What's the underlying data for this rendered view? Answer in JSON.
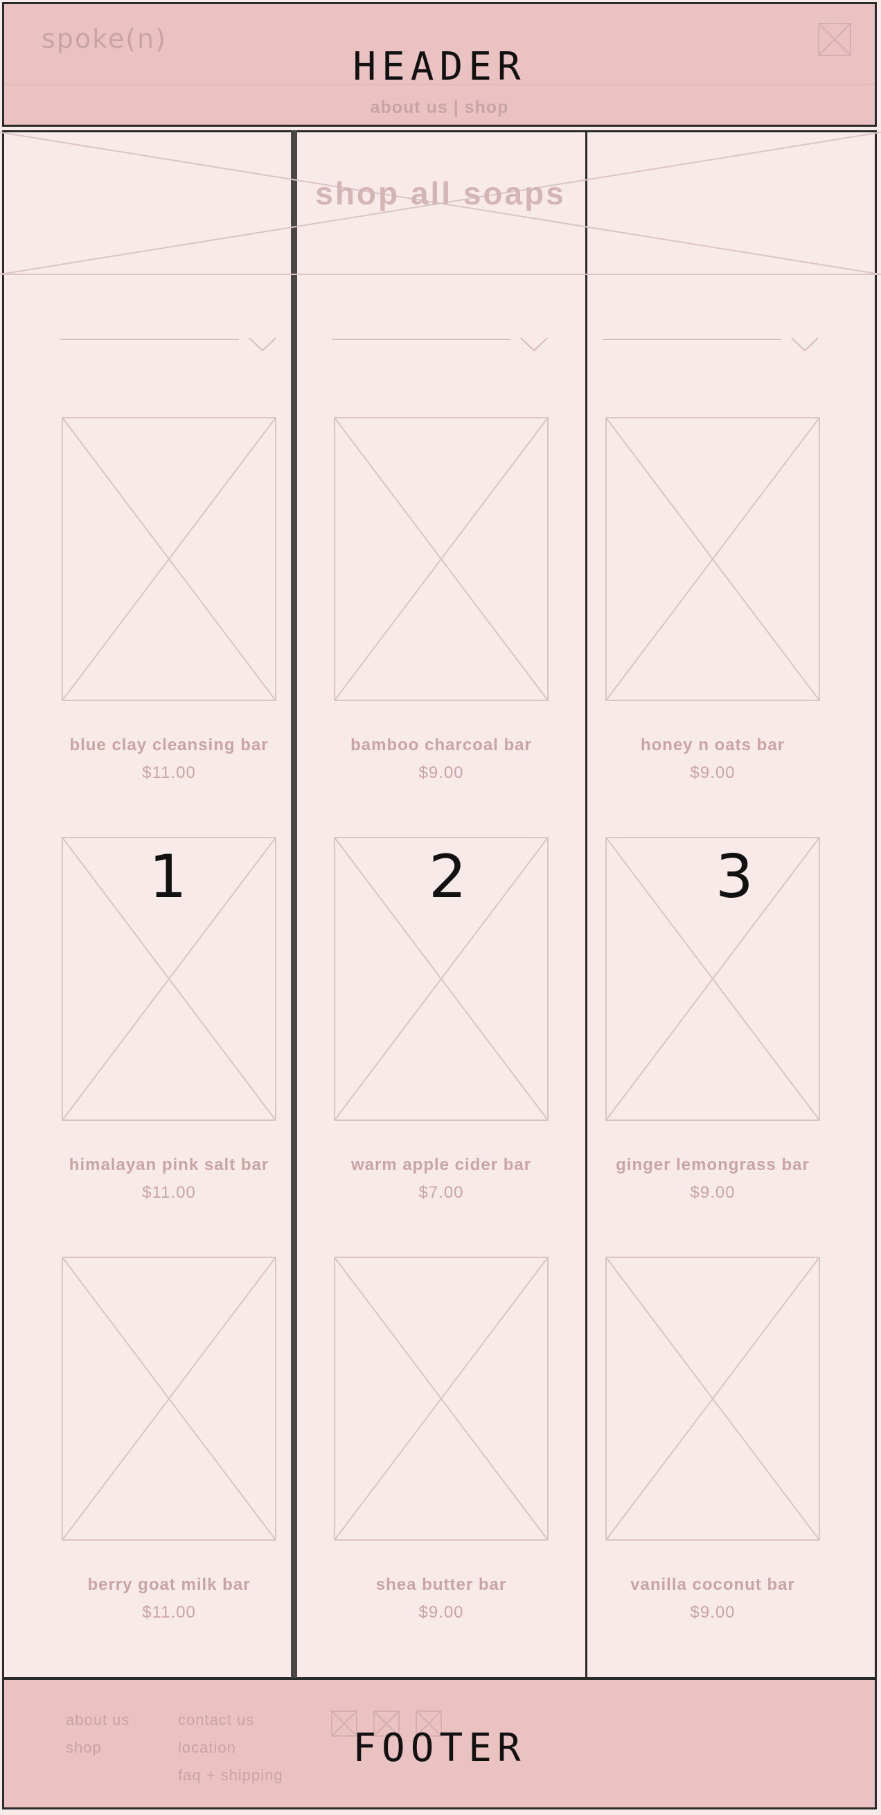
{
  "header": {
    "brand": "spoke(n)",
    "title": "HEADER",
    "nav": {
      "about": "about us",
      "separator": "|",
      "shop": "shop"
    },
    "cart_icon": "image-placeholder-icon"
  },
  "banner": {
    "title": "shop all soaps"
  },
  "filters": [
    {
      "icon": "chevron-down-icon"
    },
    {
      "icon": "chevron-down-icon"
    },
    {
      "icon": "chevron-down-icon"
    }
  ],
  "products": [
    {
      "name": "blue clay cleansing bar",
      "price": "$11.00"
    },
    {
      "name": "bamboo charcoal bar",
      "price": "$9.00"
    },
    {
      "name": "honey n oats bar",
      "price": "$9.00"
    },
    {
      "name": "himalayan pink salt bar",
      "price": "$11.00"
    },
    {
      "name": "warm apple cider bar",
      "price": "$7.00"
    },
    {
      "name": "ginger lemongrass bar",
      "price": "$9.00"
    },
    {
      "name": "berry goat milk bar",
      "price": "$11.00"
    },
    {
      "name": "shea butter bar",
      "price": "$9.00"
    },
    {
      "name": "vanilla coconut bar",
      "price": "$9.00"
    }
  ],
  "column_numbers": [
    "1",
    "2",
    "3"
  ],
  "footer": {
    "title": "FOOTER",
    "links": [
      "about us",
      "shop",
      "contact us",
      "location",
      "faq + shipping"
    ],
    "social_icons": [
      "image-placeholder-icon",
      "image-placeholder-icon",
      "image-placeholder-icon"
    ]
  },
  "colors": {
    "header_bg": "#eac2c2",
    "page_bg": "#f9eaea",
    "muted_text": "#c9a4a5",
    "placeholder_stroke": "#d9c4c6",
    "border": "#2a2a2a"
  }
}
